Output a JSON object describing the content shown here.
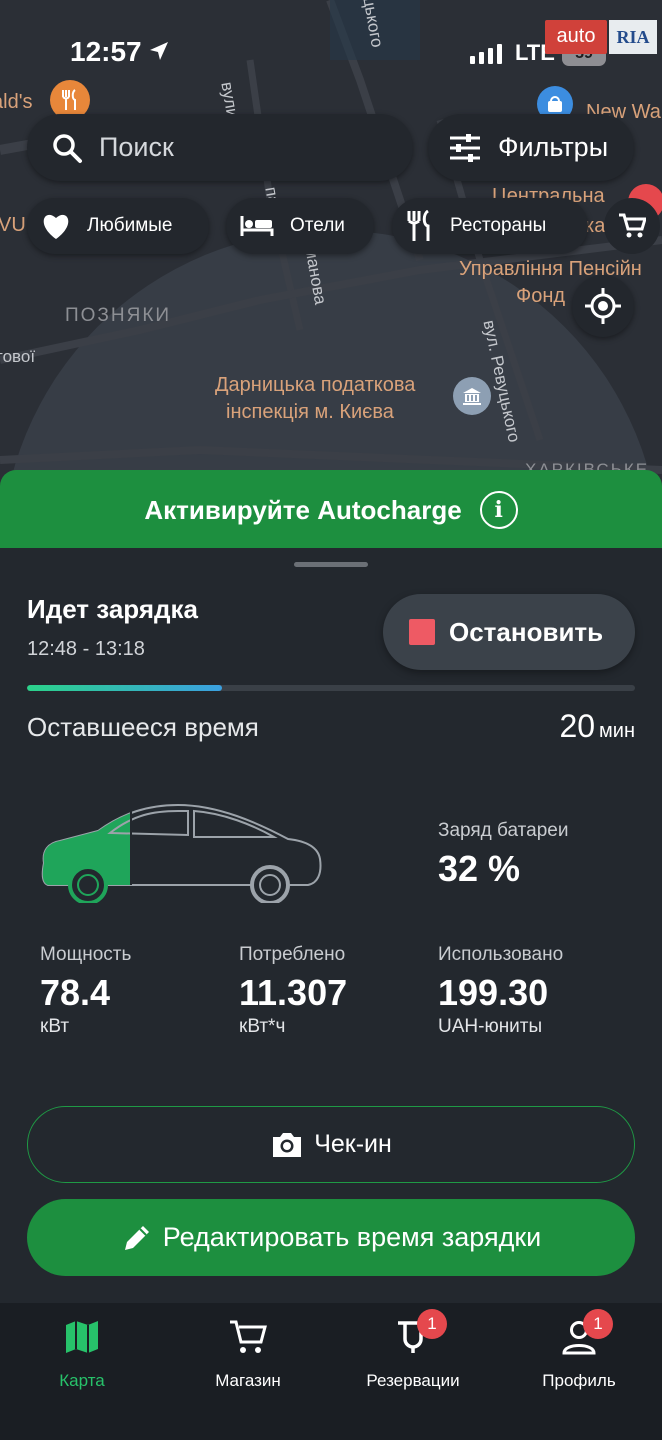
{
  "status_bar": {
    "time": "12:57",
    "network": "LTE",
    "battery": "59"
  },
  "watermark": {
    "left": "auto",
    "right": "RIA"
  },
  "map": {
    "labels": {
      "mcdonalds": "ald's",
      "new_way": "New Wa",
      "vu": "VU",
      "street_vulytsia": "вулиця",
      "street_tskoho": "цького",
      "street_manova": "манова",
      "street_pa": "па",
      "centralna": "Центральна",
      "ka": "ка",
      "pension_fund": "Управління Пенсійн",
      "pension_fund_2": "Фонд",
      "district": "ПОЗНЯКИ",
      "tovoi": "тової",
      "revutskoho": "вул. Ревуцького",
      "tax_office": "Дарницька податкова",
      "tax_office_2": "інспекція м. Києва",
      "kharkivske": "ХАРКІВСЬКЕ"
    }
  },
  "search": {
    "placeholder": "Поиск"
  },
  "filters": {
    "label": "Фильтры"
  },
  "chips": [
    {
      "label": "Любимые"
    },
    {
      "label": "Отели"
    },
    {
      "label": "Рестораны"
    }
  ],
  "autocharge": {
    "label": "Активируйте Autocharge",
    "info_glyph": "i"
  },
  "session": {
    "title": "Идет зарядка",
    "time_range": "12:48 - 13:18",
    "stop_label": "Остановить",
    "progress": 0.32,
    "remaining_label": "Оставшееся время",
    "remaining_value": "20",
    "remaining_unit": "мин"
  },
  "stats": {
    "battery": {
      "title": "Заряд батареи",
      "value": "32 %"
    },
    "power": {
      "title": "Мощность",
      "value": "78.4",
      "unit": "кВт"
    },
    "consumed": {
      "title": "Потреблено",
      "value": "11.307",
      "unit": "кВт*ч"
    },
    "used": {
      "title": "Использовано",
      "value": "199.30",
      "unit": "UAH-юниты"
    }
  },
  "actions": {
    "checkin": "Чек-ин",
    "edit_time": "Редактировать время зарядки"
  },
  "tabs": [
    {
      "label": "Карта",
      "icon": "map-icon",
      "active": true
    },
    {
      "label": "Магазин",
      "icon": "cart-icon"
    },
    {
      "label": "Резервации",
      "icon": "reservation-icon",
      "badge": "1"
    },
    {
      "label": "Профиль",
      "icon": "profile-icon",
      "badge": "1"
    }
  ],
  "colors": {
    "accent_green": "#1d8f3f",
    "active_tab": "#27c26a",
    "stop_red": "#ee5a64",
    "badge_red": "#e5484d",
    "car_green": "#1fa55a"
  }
}
